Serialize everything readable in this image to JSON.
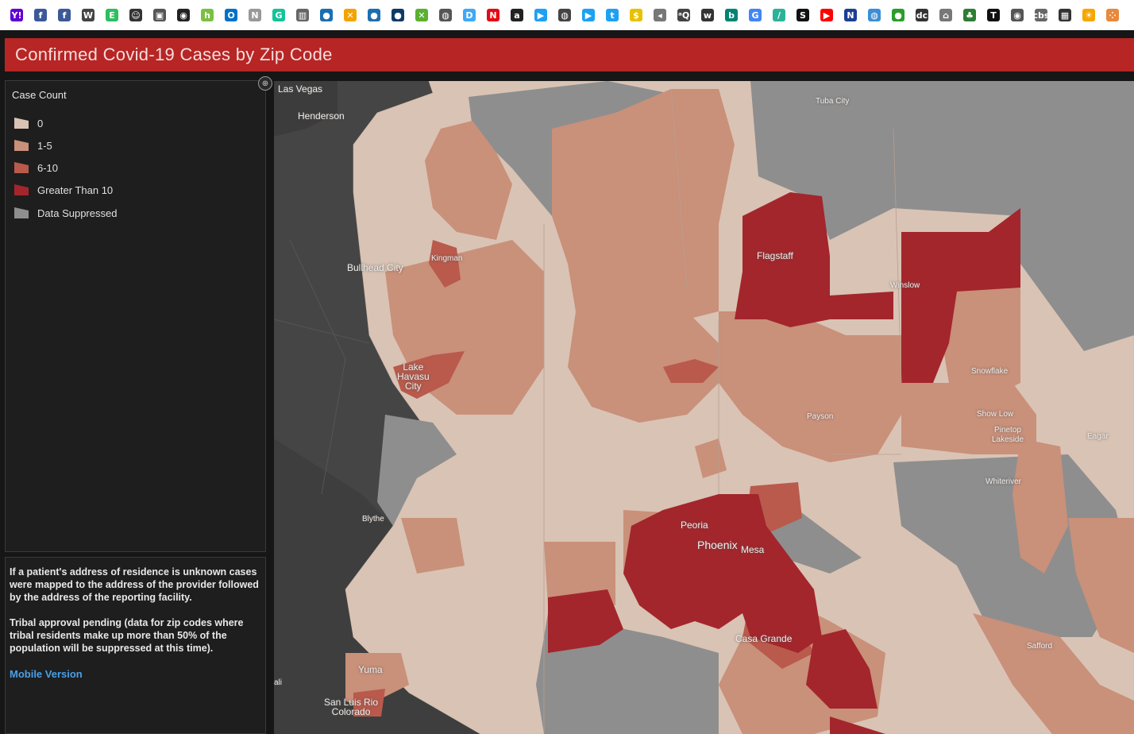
{
  "banner": {
    "title": "Confirmed Covid-19 Cases by Zip Code"
  },
  "bookmarks": [
    {
      "icon": "yahoo-icon",
      "glyph": "Y!",
      "color": "#6001d2"
    },
    {
      "icon": "facebook-icon",
      "glyph": "f",
      "color": "#3b5998"
    },
    {
      "icon": "facebook-icon",
      "glyph": "f",
      "color": "#3b5998"
    },
    {
      "icon": "wikipedia-icon",
      "glyph": "W",
      "color": "#444"
    },
    {
      "icon": "evernote-icon",
      "glyph": "E",
      "color": "#2dbe60"
    },
    {
      "icon": "person-icon",
      "glyph": "☺",
      "color": "#333"
    },
    {
      "icon": "image-icon",
      "glyph": "▣",
      "color": "#555"
    },
    {
      "icon": "camera-icon",
      "glyph": "◉",
      "color": "#222"
    },
    {
      "icon": "houzz-icon",
      "glyph": "h",
      "color": "#7ac142"
    },
    {
      "icon": "outlook-icon",
      "glyph": "O",
      "color": "#0072c6"
    },
    {
      "icon": "news-icon",
      "glyph": "N",
      "color": "#999"
    },
    {
      "icon": "grammarly-icon",
      "glyph": "G",
      "color": "#15c39a"
    },
    {
      "icon": "library-icon",
      "glyph": "▥",
      "color": "#666"
    },
    {
      "icon": "news-icon",
      "glyph": "●",
      "color": "#1a6fb0"
    },
    {
      "icon": "joomla-icon",
      "glyph": "✕",
      "color": "#f4a300"
    },
    {
      "icon": "news-icon",
      "glyph": "●",
      "color": "#1a6fb0"
    },
    {
      "icon": "news-icon",
      "glyph": "●",
      "color": "#0d3b66"
    },
    {
      "icon": "joomla-icon",
      "glyph": "✕",
      "color": "#5ab031"
    },
    {
      "icon": "globe-icon",
      "glyph": "◍",
      "color": "#555"
    },
    {
      "icon": "d-icon",
      "glyph": "D",
      "color": "#3fa9f5"
    },
    {
      "icon": "netflix-icon",
      "glyph": "N",
      "color": "#e50914"
    },
    {
      "icon": "amazon-icon",
      "glyph": "a",
      "color": "#222"
    },
    {
      "icon": "play-icon",
      "glyph": "▶",
      "color": "#1da1f2"
    },
    {
      "icon": "globe-icon",
      "glyph": "◍",
      "color": "#444"
    },
    {
      "icon": "play-icon",
      "glyph": "▶",
      "color": "#1da1f2"
    },
    {
      "icon": "twitter-icon",
      "glyph": "t",
      "color": "#1da1f2"
    },
    {
      "icon": "coin-icon",
      "glyph": "$",
      "color": "#e6c200"
    },
    {
      "icon": "audio-icon",
      "glyph": "◂",
      "color": "#777"
    },
    {
      "icon": "text-icon",
      "glyph": "ᵃQ",
      "color": "#444"
    },
    {
      "icon": "wiki-bracket-icon",
      "glyph": "w",
      "color": "#333"
    },
    {
      "icon": "bing-icon",
      "glyph": "b",
      "color": "#008373"
    },
    {
      "icon": "google-icon",
      "glyph": "G",
      "color": "#4285f4"
    },
    {
      "icon": "slash-icon",
      "glyph": "/",
      "color": "#2db29a"
    },
    {
      "icon": "s-icon",
      "glyph": "S",
      "color": "#111"
    },
    {
      "icon": "youtube-icon",
      "glyph": "▶",
      "color": "#ff0000"
    },
    {
      "icon": "n-icon",
      "glyph": "N",
      "color": "#1c3f94"
    },
    {
      "icon": "globe-icon",
      "glyph": "◍",
      "color": "#3b8ed6"
    },
    {
      "icon": "circle-icon",
      "glyph": "●",
      "color": "#2a9d2a"
    },
    {
      "icon": "dc-icon",
      "glyph": "dc",
      "color": "#333"
    },
    {
      "icon": "home-icon",
      "glyph": "⌂",
      "color": "#777"
    },
    {
      "icon": "tree-icon",
      "glyph": "♣",
      "color": "#2e7d32"
    },
    {
      "icon": "t-icon",
      "glyph": "T",
      "color": "#111"
    },
    {
      "icon": "eye-icon",
      "glyph": "◉",
      "color": "#555"
    },
    {
      "icon": "cbs-icon",
      "glyph": "cbs",
      "color": "#666"
    },
    {
      "icon": "grid-icon",
      "glyph": "▦",
      "color": "#333"
    },
    {
      "icon": "sun-icon",
      "glyph": "☀",
      "color": "#f7a600"
    },
    {
      "icon": "dots-icon",
      "glyph": "⁘",
      "color": "#e8893c"
    }
  ],
  "legend": {
    "title": "Case Count",
    "items": [
      {
        "label": "0",
        "color": "#d9c3b4"
      },
      {
        "label": "1-5",
        "color": "#c9907a"
      },
      {
        "label": "6-10",
        "color": "#b95a4c"
      },
      {
        "label": "Greater Than 10",
        "color": "#a3262c"
      },
      {
        "label": "Data Suppressed",
        "color": "#8e8e8e"
      }
    ]
  },
  "notes": {
    "note1": "If a patient's address of residence is unknown cases were mapped to the address of the provider followed by the address of the reporting facility.",
    "note2": "Tribal approval pending (data for zip codes where tribal residents make up more than 50% of the population will be suppressed at this time).",
    "mobile_link": "Mobile Version"
  },
  "map": {
    "cities": {
      "las_vegas": "Las Vegas",
      "henderson": "Henderson",
      "tuba_city": "Tuba City",
      "kingman": "Kingman",
      "bullhead_city": "Bullhead City",
      "flagstaff": "Flagstaff",
      "winslow": "Winslow",
      "lake_havasu_1": "Lake",
      "lake_havasu_2": "Havasu",
      "lake_havasu_3": "City",
      "snowflake": "Snowflake",
      "payson": "Payson",
      "show_low": "Show Low",
      "pinetop_1": "Pinetop",
      "pinetop_2": "Lakeside",
      "eagar": "Eagar",
      "whiteriver": "Whiteriver",
      "blythe": "Blythe",
      "peoria": "Peoria",
      "phoenix": "Phoenix",
      "mesa": "Mesa",
      "casa_grande": "Casa Grande",
      "safford": "Safford",
      "yuma": "Yuma",
      "san_luis_1": "San Luis Rio",
      "san_luis_2": "Colorado",
      "cali": "ali"
    }
  }
}
